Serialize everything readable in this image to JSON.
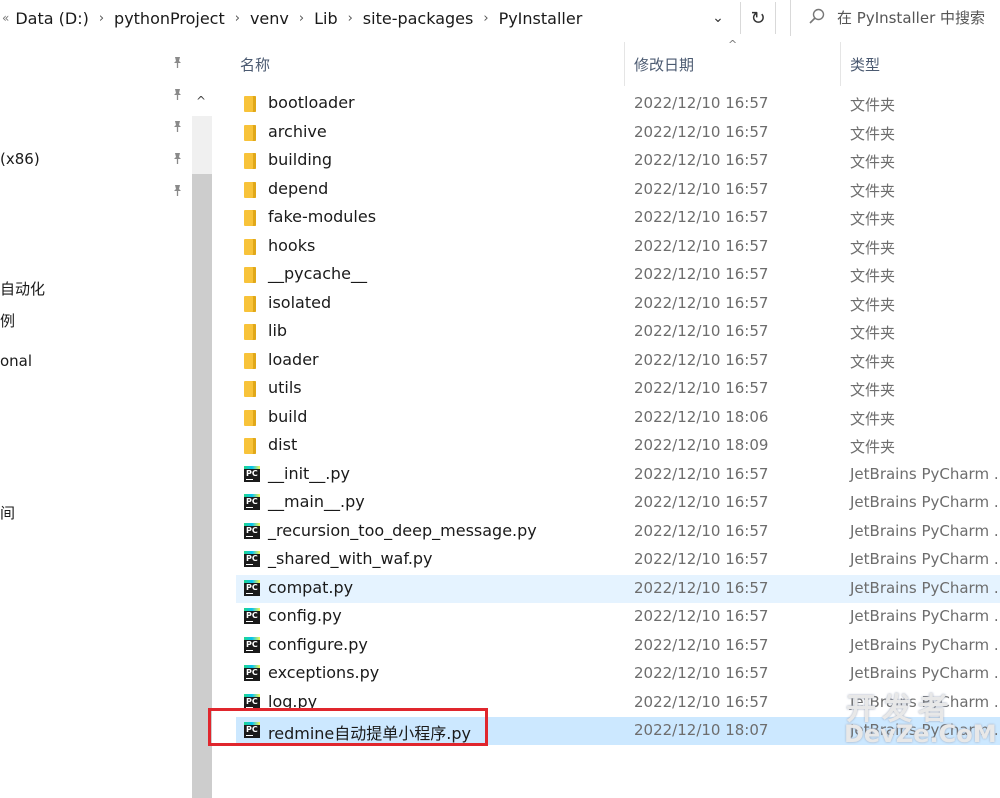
{
  "address_bar": {
    "lead_glyph": "«",
    "crumbs": [
      "Data (D:)",
      "pythonProject",
      "venv",
      "Lib",
      "site-packages",
      "PyInstaller"
    ],
    "separator": "›",
    "dropdown_glyph": "⌄",
    "refresh_glyph": "↻"
  },
  "search": {
    "placeholder": "在 PyInstaller 中搜索",
    "icon": "search-icon"
  },
  "nav_pane": {
    "items": [
      {
        "label": "(x86)"
      },
      {
        "label": "自动化"
      },
      {
        "label": "例"
      },
      {
        "label": "onal"
      },
      {
        "label": "间"
      }
    ],
    "pin_glyph": "📌",
    "scroll_up_glyph": "^"
  },
  "columns": {
    "name": "名称",
    "modified": "修改日期",
    "type": "类型",
    "sort_caret": "^"
  },
  "files": [
    {
      "name": "bootloader",
      "date": "2022/12/10 16:57",
      "type": "文件夹",
      "kind": "folder"
    },
    {
      "name": "archive",
      "date": "2022/12/10 16:57",
      "type": "文件夹",
      "kind": "folder"
    },
    {
      "name": "building",
      "date": "2022/12/10 16:57",
      "type": "文件夹",
      "kind": "folder"
    },
    {
      "name": "depend",
      "date": "2022/12/10 16:57",
      "type": "文件夹",
      "kind": "folder"
    },
    {
      "name": "fake-modules",
      "date": "2022/12/10 16:57",
      "type": "文件夹",
      "kind": "folder"
    },
    {
      "name": "hooks",
      "date": "2022/12/10 16:57",
      "type": "文件夹",
      "kind": "folder"
    },
    {
      "name": "__pycache__",
      "date": "2022/12/10 16:57",
      "type": "文件夹",
      "kind": "folder"
    },
    {
      "name": "isolated",
      "date": "2022/12/10 16:57",
      "type": "文件夹",
      "kind": "folder"
    },
    {
      "name": "lib",
      "date": "2022/12/10 16:57",
      "type": "文件夹",
      "kind": "folder"
    },
    {
      "name": "loader",
      "date": "2022/12/10 16:57",
      "type": "文件夹",
      "kind": "folder"
    },
    {
      "name": "utils",
      "date": "2022/12/10 16:57",
      "type": "文件夹",
      "kind": "folder"
    },
    {
      "name": "build",
      "date": "2022/12/10 18:06",
      "type": "文件夹",
      "kind": "folder"
    },
    {
      "name": "dist",
      "date": "2022/12/10 18:09",
      "type": "文件夹",
      "kind": "folder"
    },
    {
      "name": "__init__.py",
      "date": "2022/12/10 16:57",
      "type": "JetBrains PyCharm ...",
      "kind": "py"
    },
    {
      "name": "__main__.py",
      "date": "2022/12/10 16:57",
      "type": "JetBrains PyCharm ...",
      "kind": "py"
    },
    {
      "name": "_recursion_too_deep_message.py",
      "date": "2022/12/10 16:57",
      "type": "JetBrains PyCharm ...",
      "kind": "py"
    },
    {
      "name": "_shared_with_waf.py",
      "date": "2022/12/10 16:57",
      "type": "JetBrains PyCharm ...",
      "kind": "py"
    },
    {
      "name": "compat.py",
      "date": "2022/12/10 16:57",
      "type": "JetBrains PyCharm ...",
      "kind": "py",
      "state": "hover"
    },
    {
      "name": "config.py",
      "date": "2022/12/10 16:57",
      "type": "JetBrains PyCharm ...",
      "kind": "py"
    },
    {
      "name": "configure.py",
      "date": "2022/12/10 16:57",
      "type": "JetBrains PyCharm ...",
      "kind": "py"
    },
    {
      "name": "exceptions.py",
      "date": "2022/12/10 16:57",
      "type": "JetBrains PyCharm ...",
      "kind": "py"
    },
    {
      "name": "log.py",
      "date": "2022/12/10 16:57",
      "type": "JetBrains PyCharm ...",
      "kind": "py"
    },
    {
      "name": "redmine自动提单小程序.py",
      "date": "2022/12/10 18:07",
      "type": "JetBrains PyCharm ...",
      "kind": "py",
      "state": "selected"
    }
  ],
  "py_icon_text": "PC",
  "watermark": {
    "top": "开发者",
    "bottom": "DevZe.CoM"
  },
  "colors": {
    "accent_border": "#e0262d",
    "hover_row": "#e5f3ff",
    "selected_row": "#cce8ff",
    "folder": "#f8c33a"
  }
}
